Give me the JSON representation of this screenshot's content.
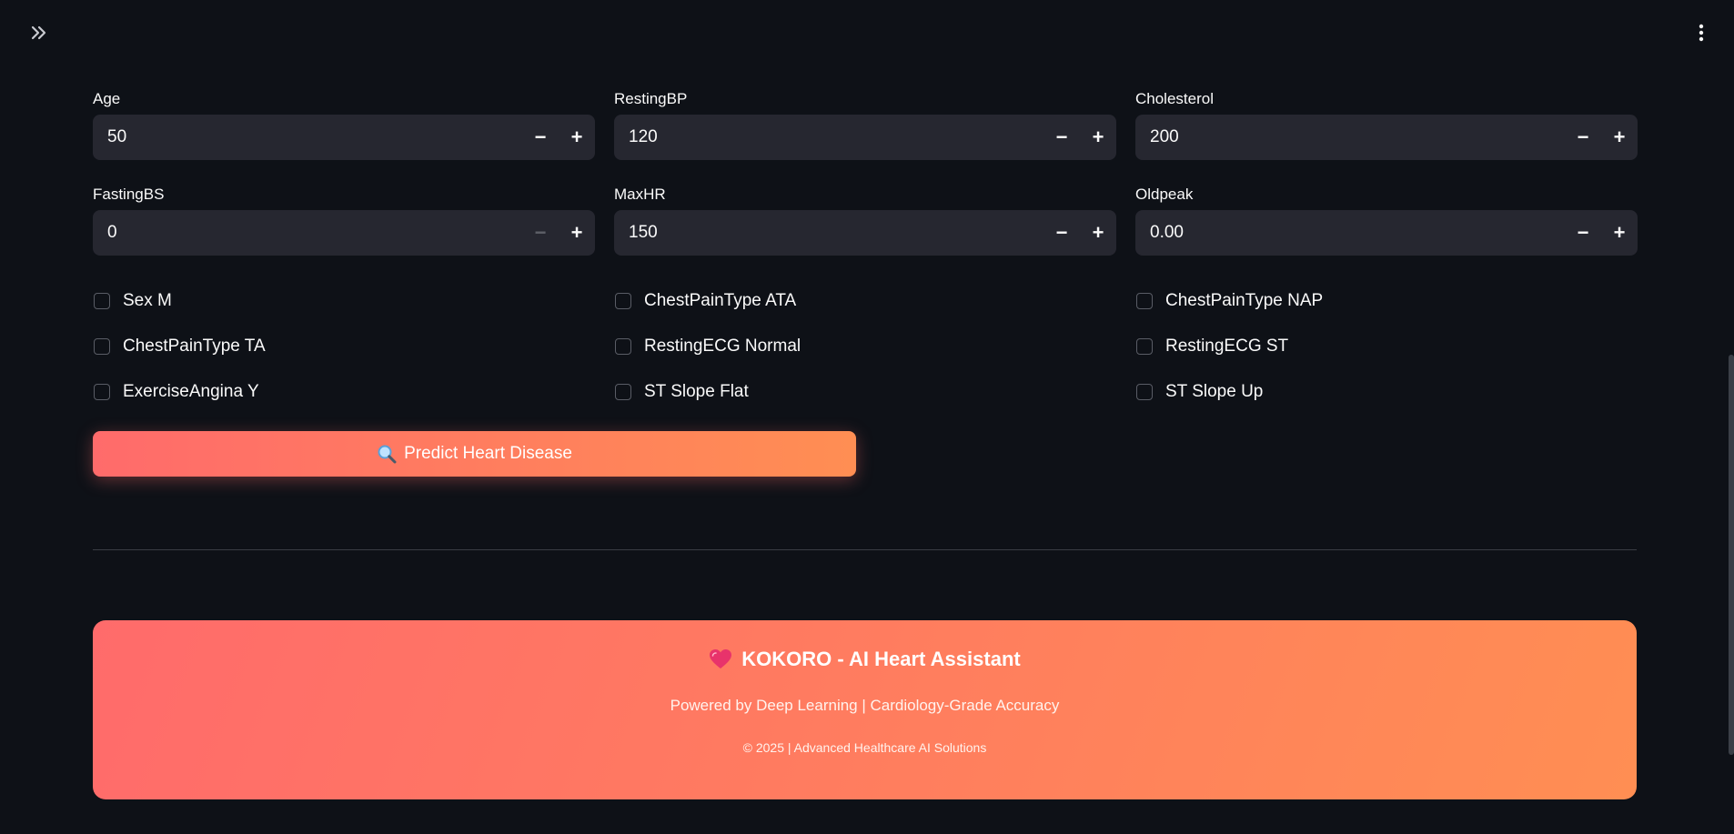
{
  "toolbar": {
    "expand_icon": "double-chevron-right-icon",
    "menu_icon": "vertical-dots-icon"
  },
  "inputs": [
    {
      "label": "Age",
      "value": "50",
      "minus_disabled": false
    },
    {
      "label": "RestingBP",
      "value": "120",
      "minus_disabled": false
    },
    {
      "label": "Cholesterol",
      "value": "200",
      "minus_disabled": false
    },
    {
      "label": "FastingBS",
      "value": "0",
      "minus_disabled": true
    },
    {
      "label": "MaxHR",
      "value": "150",
      "minus_disabled": false
    },
    {
      "label": "Oldpeak",
      "value": "0.00",
      "minus_disabled": false
    }
  ],
  "steppers": {
    "minus": "−",
    "plus": "+"
  },
  "checkboxes": [
    {
      "label": "Sex M",
      "checked": false
    },
    {
      "label": "ChestPainType ATA",
      "checked": false
    },
    {
      "label": "ChestPainType NAP",
      "checked": false
    },
    {
      "label": "ChestPainType TA",
      "checked": false
    },
    {
      "label": "RestingECG Normal",
      "checked": false
    },
    {
      "label": "RestingECG ST",
      "checked": false
    },
    {
      "label": "ExerciseAngina Y",
      "checked": false
    },
    {
      "label": "ST Slope Flat",
      "checked": false
    },
    {
      "label": "ST Slope Up",
      "checked": false
    }
  ],
  "predict": {
    "label": "Predict Heart Disease",
    "icon": "magnifier-icon"
  },
  "footer": {
    "title": "KOKORO - AI Heart Assistant",
    "title_icon": "heart-icon",
    "subtitle": "Powered by Deep Learning | Cardiology-Grade Accuracy",
    "copyright": "© 2025 | Advanced Healthcare AI Solutions"
  },
  "colors": {
    "background": "#0e1117",
    "input_bg": "#262730",
    "gradient_start": "#ff6b6b",
    "gradient_end": "#ff8e53"
  }
}
